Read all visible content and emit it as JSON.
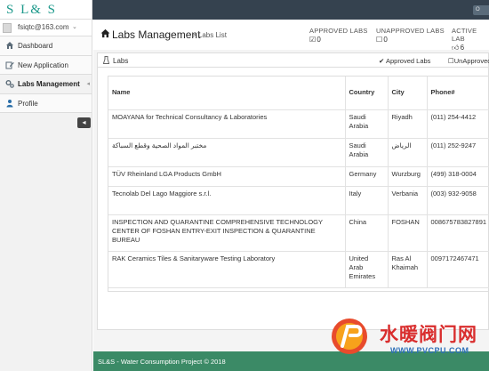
{
  "brand": {
    "logo_text": "S L& S"
  },
  "topbar": {
    "button_label": "O"
  },
  "user": {
    "email": "fsiqtc@163.com",
    "caret": "⌄"
  },
  "sidebar": {
    "items": [
      {
        "label": "Dashboard",
        "icon": "dashboard-icon"
      },
      {
        "label": "New Application",
        "icon": "edit-icon"
      },
      {
        "label": "Labs Management",
        "icon": "gears-icon",
        "active": true
      },
      {
        "label": "Profile",
        "icon": "user-icon"
      }
    ],
    "collapse_arrow": "◂",
    "collapse_button": "◂"
  },
  "header": {
    "title": "Labs Management",
    "subtitle": "> Labs List",
    "stats": [
      {
        "label": "APPROVED LABS",
        "value": "0",
        "icon": "check-square-icon"
      },
      {
        "label": "UNAPPROVED LABS",
        "value": "0",
        "icon": "square-icon"
      },
      {
        "label": "ACTIVE LAB",
        "value": "6",
        "icon": "thumbs-up-icon"
      }
    ]
  },
  "panel": {
    "title": "Labs",
    "legend_approved": "Approved Labs",
    "legend_unapproved": "UnApproved"
  },
  "table": {
    "columns": [
      "Name",
      "Country",
      "City",
      "Phone#"
    ],
    "rows": [
      {
        "name": "MOAYANA for Technical Consultancy & Laboratories",
        "country": "Saudi Arabia",
        "city": "Riyadh",
        "phone": "(011) 254-4412"
      },
      {
        "name": "مختبر المواد الصحية وقطع السباكة",
        "country": "Saudi Arabia",
        "city": "الرياض",
        "phone": "(011) 252-9247"
      },
      {
        "name": "TÜV Rheinland LGA Products GmbH",
        "country": "Germany",
        "city": "Wurzburg",
        "phone": "(499) 318-0004"
      },
      {
        "name": "Tecnolab Del Lago Maggiore s.r.l.",
        "country": "Italy",
        "city": "Verbania",
        "phone": "(003) 932-9058"
      },
      {
        "name": "INSPECTION AND QUARANTINE COMPREHENSIVE TECHNOLOGY CENTER OF FOSHAN ENTRY-EXIT INSPECTION & QUARANTINE BUREAU",
        "country": "China",
        "city": "FOSHAN",
        "phone": "008675783827891"
      },
      {
        "name": "RAK Ceramics Tiles & Sanitaryware Testing Laboratory",
        "country": "United Arab Emirates",
        "city": "Ras Al Khaimah",
        "phone": "0097172467471"
      }
    ]
  },
  "footer": {
    "text": "SL&S - Water Consumption Project © 2018"
  },
  "watermark": {
    "cn_text": "水暖阀门网",
    "url": "WWW.PVCPU.COM"
  },
  "colors": {
    "topbar": "#35424f",
    "brand": "#1f9a8c",
    "footer": "#3b8a66",
    "watermark_red": "#d92d2d",
    "watermark_blue": "#2d6fb8"
  }
}
